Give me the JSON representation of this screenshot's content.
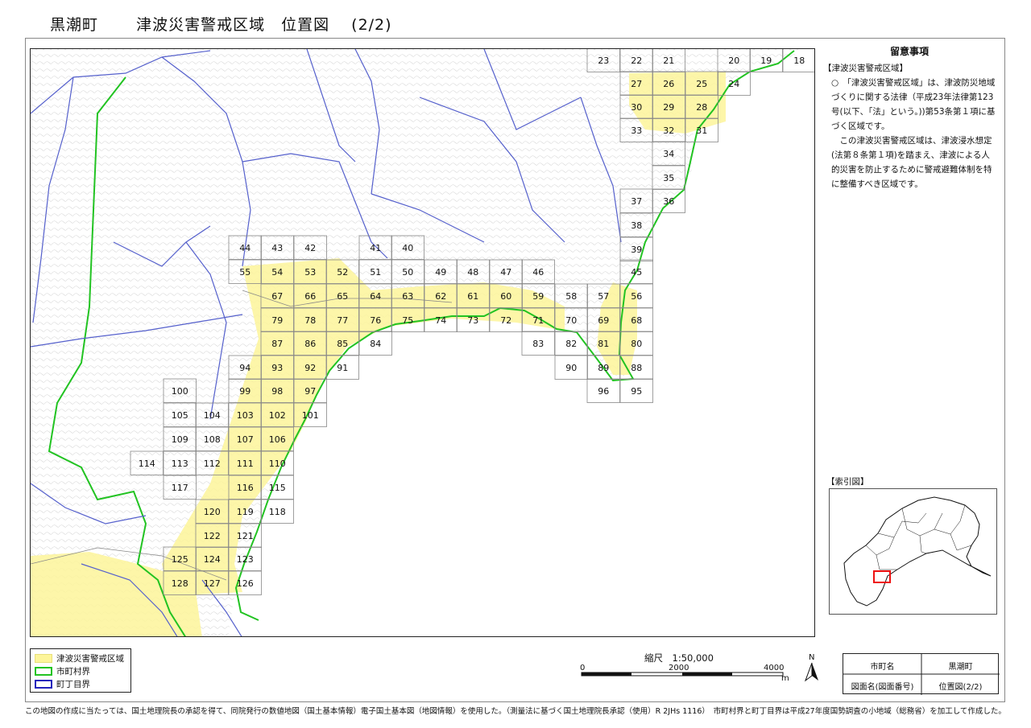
{
  "header": {
    "town": "黒潮町",
    "title": "津波災害警戒区域",
    "subtitle": "位置図",
    "page": "(2/2)"
  },
  "notes": {
    "heading": "留意事項",
    "section": "【津波災害警戒区域】",
    "para1": "○　「津波災害警戒区域」は、津波防災地域づくりに関する法律（平成23年法律第123号(以下、「法」という。))第53条第１項に基づく区域です。",
    "para2": "　この津波災害警戒区域は、津波浸水想定(法第８条第１項)を踏まえ、津波による人的災害を防止するために警戒避難体制を特に整備すべき区域です。"
  },
  "index_map": {
    "title": "【索引図】"
  },
  "legend": {
    "items": [
      {
        "label": "津波災害警戒区域",
        "color": "#fdf59a",
        "kind": "fill"
      },
      {
        "label": "市町村界",
        "color": "#22c322",
        "kind": "outline"
      },
      {
        "label": "町丁目界",
        "color": "#2222bb",
        "kind": "outline"
      }
    ]
  },
  "scale": {
    "label": "縮尺　1:50,000",
    "ticks": [
      "0",
      "2000",
      "4000"
    ],
    "unit": "m",
    "north": "N"
  },
  "info_table": {
    "k1": "市町名",
    "v1": "黒潮町",
    "k2": "図面名(図面番号)",
    "v2": "位置図(2/2)"
  },
  "footer": "この地図の作成に当たっては、国土地理院長の承認を得て、同院発行の数値地図（国土基本情報）電子国土基本図（地図情報）を使用した。（測量法に基づく国土地理院長承認（使用）R 2JHs 1116）　市町村界と町丁目界は平成27年度国勢調査の小地域（総務省）を加工して作成した。",
  "grid_labels": {
    "r0": [
      "23",
      "22",
      "21",
      "20",
      "19",
      "18"
    ],
    "r1": [
      "27",
      "26",
      "25",
      "24"
    ],
    "r2": [
      "30",
      "29",
      "28"
    ],
    "r3": [
      "33",
      "32",
      "31"
    ],
    "r4": [
      "34",
      "35",
      "37",
      "36",
      "38",
      "39"
    ],
    "r5": [
      "44",
      "43",
      "42",
      "41",
      "40"
    ],
    "r6": [
      "55",
      "54",
      "53",
      "52",
      "51",
      "50",
      "49",
      "48",
      "47",
      "46",
      "45"
    ],
    "r7": [
      "67",
      "66",
      "65",
      "64",
      "63",
      "62",
      "61",
      "60",
      "59",
      "58",
      "57",
      "56"
    ],
    "r8": [
      "79",
      "78",
      "77",
      "76",
      "75",
      "74",
      "73",
      "72",
      "71",
      "70",
      "69",
      "68"
    ],
    "r9": [
      "87",
      "86",
      "85",
      "84",
      "83",
      "82",
      "81",
      "80"
    ],
    "r10": [
      "94",
      "93",
      "92",
      "91",
      "90",
      "89",
      "88"
    ],
    "r11": [
      "100",
      "99",
      "98",
      "97",
      "96",
      "95"
    ],
    "r12": [
      "105",
      "104",
      "103",
      "102",
      "101"
    ],
    "r13": [
      "109",
      "108",
      "107",
      "106"
    ],
    "r14": [
      "114",
      "113",
      "112",
      "111",
      "110"
    ],
    "r15": [
      "117",
      "116",
      "115"
    ],
    "r16": [
      "120",
      "119",
      "118"
    ],
    "r17": [
      "122",
      "121"
    ],
    "r18": [
      "125",
      "124",
      "123"
    ],
    "r19": [
      "128",
      "127",
      "126"
    ]
  }
}
